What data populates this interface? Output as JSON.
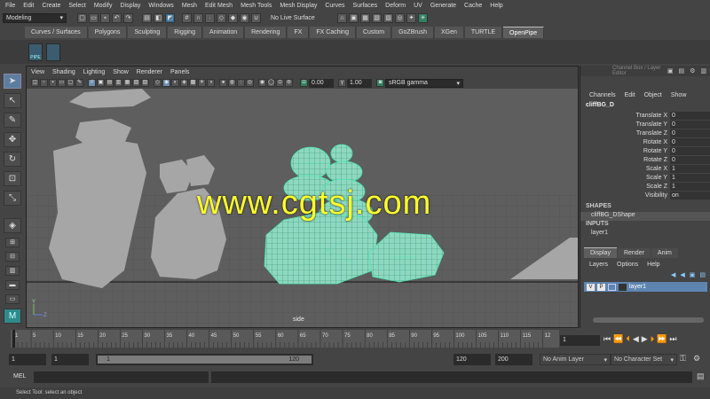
{
  "menubar": [
    "File",
    "Edit",
    "Create",
    "Select",
    "Modify",
    "Display",
    "Windows",
    "Mesh",
    "Edit Mesh",
    "Mesh Tools",
    "Mesh Display",
    "Curves",
    "Surfaces",
    "Deform",
    "UV",
    "Generate",
    "Cache",
    "Help"
  ],
  "statusline": {
    "mode": "Modeling",
    "live_surface": "No Live Surface"
  },
  "shelf_tabs": [
    "Curves / Surfaces",
    "Polygons",
    "Sculpting",
    "Rigging",
    "Animation",
    "Rendering",
    "FX",
    "FX Caching",
    "Custom",
    "GoZBrush",
    "XGen",
    "TURTLE",
    "OpenPipe"
  ],
  "shelf_active": "OpenPipe",
  "shelf_icon_label": "PIPE",
  "panel_menu": [
    "View",
    "Shading",
    "Lighting",
    "Show",
    "Renderer",
    "Panels"
  ],
  "panel_tools": {
    "exposure": "0.00",
    "gamma": "1.00",
    "color_space": "sRGB gamma"
  },
  "viewport": {
    "camera": "side",
    "watermark": "www.cgtsj.com"
  },
  "channel_box": {
    "header": "Channel Box / Layer Editor",
    "menu": [
      "Channels",
      "Edit",
      "Object",
      "Show"
    ],
    "object": "cliffBG_D",
    "attributes": [
      {
        "name": "Translate X",
        "value": "0"
      },
      {
        "name": "Translate Y",
        "value": "0"
      },
      {
        "name": "Translate Z",
        "value": "0"
      },
      {
        "name": "Rotate X",
        "value": "0"
      },
      {
        "name": "Rotate Y",
        "value": "0"
      },
      {
        "name": "Rotate Z",
        "value": "0"
      },
      {
        "name": "Scale X",
        "value": "1"
      },
      {
        "name": "Scale Y",
        "value": "1"
      },
      {
        "name": "Scale Z",
        "value": "1"
      },
      {
        "name": "Visibility",
        "value": "on"
      }
    ],
    "shapes_header": "SHAPES",
    "shape": "cliffBG_DShape",
    "inputs_header": "INPUTS",
    "input": "layer1"
  },
  "layer_editor": {
    "tabs": [
      "Display",
      "Render",
      "Anim"
    ],
    "menu": [
      "Layers",
      "Options",
      "Help"
    ],
    "layer": {
      "v": "V",
      "p": "P",
      "name": "layer1"
    }
  },
  "time_slider": {
    "ticks": [
      "1",
      "5",
      "10",
      "15",
      "20",
      "25",
      "30",
      "35",
      "40",
      "45",
      "50",
      "55",
      "60",
      "65",
      "70",
      "75",
      "80",
      "85",
      "90",
      "95",
      "100",
      "105",
      "110",
      "115",
      "12"
    ],
    "current_frame": "1"
  },
  "range_slider": {
    "start": "1",
    "playback_start": "1",
    "range_start": "1",
    "range_end": "120",
    "playback_end": "120",
    "end": "200",
    "anim_layer": "No Anim Layer",
    "character_set": "No Character Set"
  },
  "command_line": {
    "label": "MEL"
  },
  "help_line": "Select Tool: select an object",
  "colors": {
    "accent": "#5dc3a0",
    "watermark": "#ffff2a",
    "selection": "#5d85b0"
  }
}
